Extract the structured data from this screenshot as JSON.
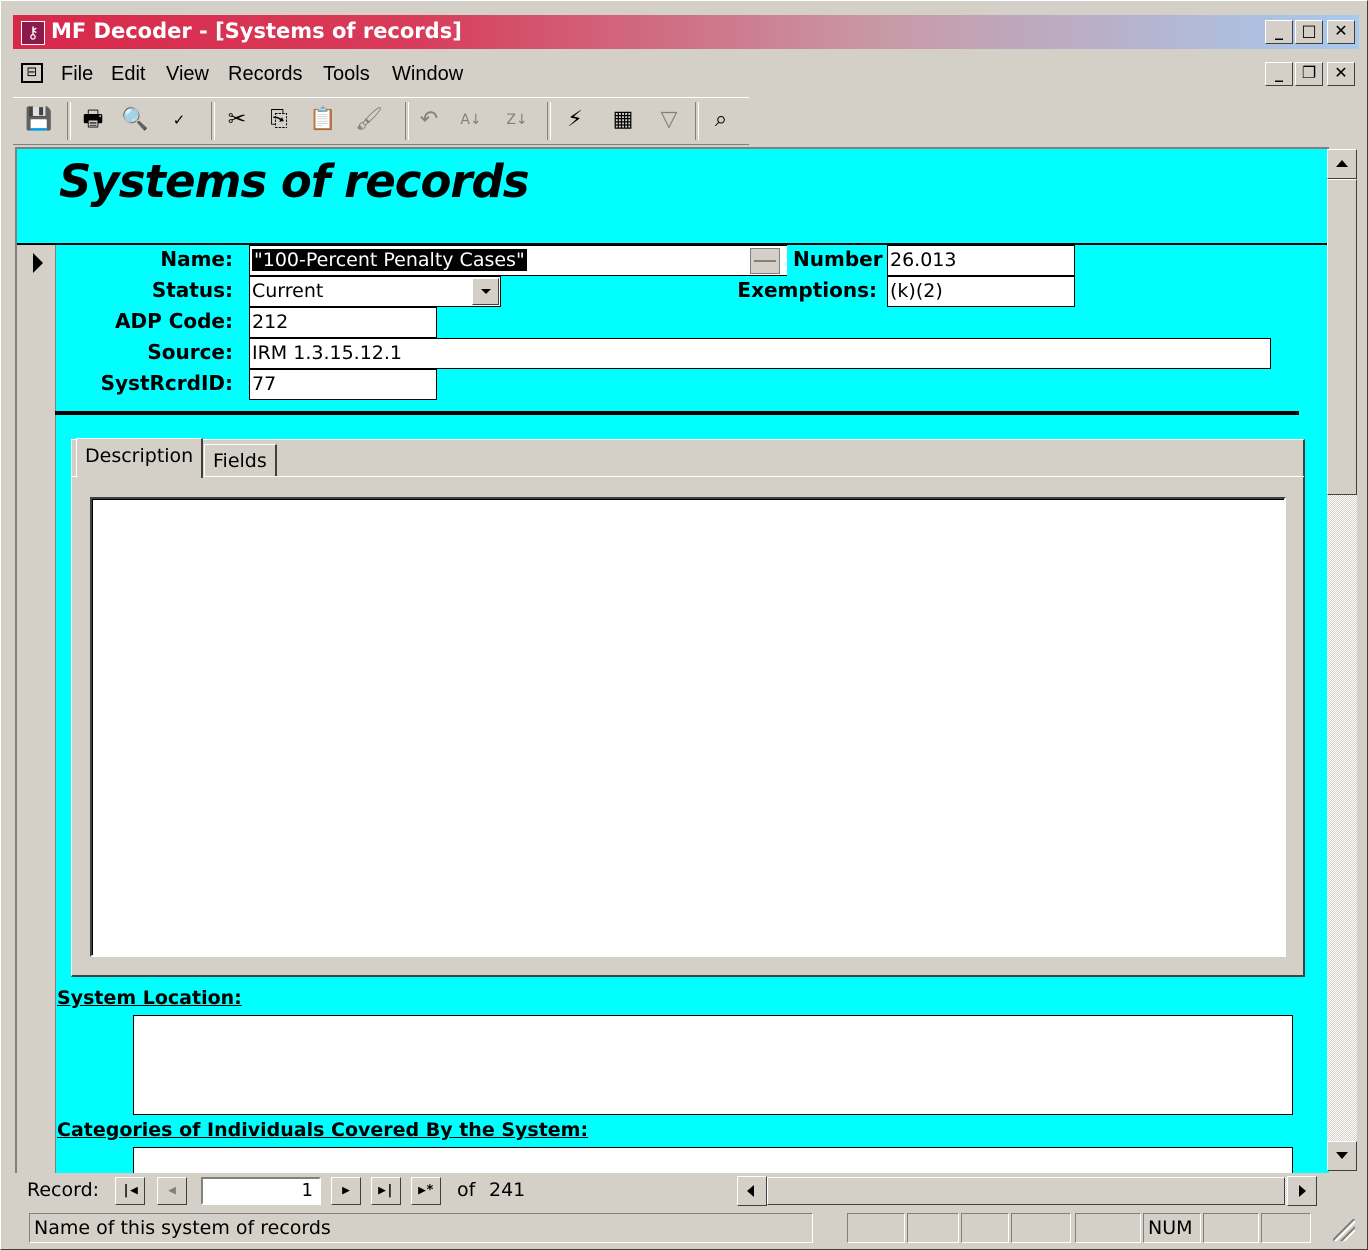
{
  "window": {
    "title": "MF Decoder - [Systems of records]",
    "app_icon": "access-key-icon"
  },
  "menu": {
    "items": [
      "File",
      "Edit",
      "View",
      "Records",
      "Tools",
      "Window"
    ]
  },
  "toolbar": {
    "buttons": [
      "save-icon",
      "print-icon",
      "print-preview-icon",
      "spelling-icon",
      "cut-icon",
      "copy-icon",
      "paste-icon",
      "format-painter-icon",
      "undo-icon",
      "sort-ascending-icon",
      "sort-descending-icon",
      "filter-by-selection-icon",
      "filter-by-form-icon",
      "apply-filter-icon",
      "find-icon"
    ]
  },
  "form": {
    "title": "Systems of records",
    "fields": {
      "name_label": "Name:",
      "name_value": "\"100-Percent Penalty Cases\"",
      "number_label": "Number",
      "number_value": "26.013",
      "status_label": "Status:",
      "status_value": "Current",
      "exemptions_label": "Exemptions:",
      "exemptions_value": "(k)(2)",
      "adp_label": "ADP Code:",
      "adp_value": "212",
      "source_label": "Source:",
      "source_value": "IRM 1.3.15.12.1",
      "systrcrdid_label": "SystRcrdID:",
      "systrcrdid_value": "77"
    },
    "tabs": [
      "Description",
      "Fields"
    ],
    "active_tab": "Description",
    "sections": {
      "system_location": "System Location:",
      "categories": "Categories of Individuals Covered By the System:"
    }
  },
  "navigation": {
    "record_label": "Record:",
    "current_record": "1",
    "of_label": "of",
    "total_records": "241"
  },
  "status": {
    "message": "Name of this system of records",
    "num_indicator": "NUM"
  },
  "colors": {
    "form_background": "#00ffff",
    "chrome": "#d4d0c8",
    "title_gradient_start": "#d8284a",
    "title_gradient_end": "#a6caf0"
  }
}
